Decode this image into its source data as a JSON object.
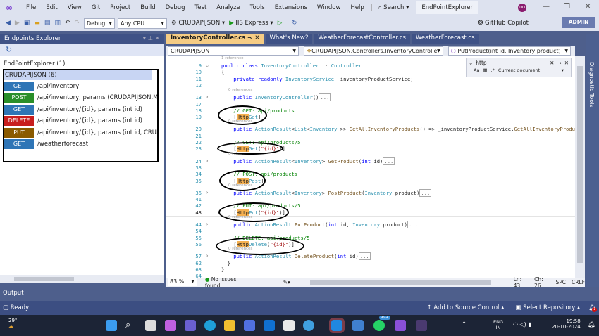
{
  "menu": [
    "File",
    "Edit",
    "View",
    "Git",
    "Project",
    "Build",
    "Debug",
    "Test",
    "Analyze",
    "Tools",
    "Extensions",
    "Window",
    "Help"
  ],
  "search_label": "Search",
  "solution_title": "EndPointExplorer",
  "avatar_initials": "DO",
  "toolbar": {
    "config": "Debug",
    "platform": "Any CPU",
    "startup": "CRUDAPIJSON",
    "run": "IIS Express",
    "copilot": "GitHub Copilot",
    "admin": "ADMIN"
  },
  "left_panel": {
    "title": "Endpoints Explorer",
    "root": "EndPointExplorer (1)",
    "group": "CRUDAPIJSON (6)",
    "endpoints": [
      {
        "verb": "GET",
        "path": "/api/inventory",
        "color": "#2e75b6"
      },
      {
        "verb": "POST",
        "path": "/api/inventory, params (CRUDAPIJSON.Model.Inventory",
        "color": "#2a8f2a"
      },
      {
        "verb": "GET",
        "path": "/api/inventory/{id}, params (int id)",
        "color": "#2e75b6"
      },
      {
        "verb": "DELETE",
        "path": "/api/inventory/{id}, params (int id)",
        "color": "#c81e1e"
      },
      {
        "verb": "PUT",
        "path": "/api/inventory/{id}, params (int id, CRUDAPIJSON.Mo",
        "color": "#8a5a00"
      },
      {
        "verb": "GET",
        "path": "/weatherforecast",
        "color": "#2e75b6"
      }
    ]
  },
  "tabs": [
    "InventoryController.cs",
    "What's New?",
    "WeatherForecastController.cs",
    "WeatherForecast.cs"
  ],
  "nav": {
    "project": "CRUDAPIJSON",
    "class": "CRUDAPIJSON.Controllers.InventoryController",
    "member": "PutProduct(int id, Inventory product)"
  },
  "find": {
    "value": "http",
    "scope": "Current document"
  },
  "code": [
    {
      "ref": "1 reference"
    },
    {
      "n": "9",
      "f": "v",
      "s": [
        [
          "kw",
          "public class "
        ],
        [
          "ty",
          "InventoryController"
        ],
        [
          "",
          "  : "
        ],
        [
          "ty",
          "Controller"
        ]
      ]
    },
    {
      "n": "10",
      "s": [
        [
          "",
          "{"
        ]
      ]
    },
    {
      "n": "11",
      "s": [
        [
          "kw",
          "    private readonly "
        ],
        [
          "ty",
          "InventoryService"
        ],
        [
          "",
          " _inventoryProductService;"
        ]
      ]
    },
    {
      "n": "12",
      "s": []
    },
    {
      "ref": "0 references"
    },
    {
      "n": "13",
      "f": ">",
      "s": [
        [
          "kw",
          "    public "
        ],
        [
          "ty",
          "InventoryController"
        ],
        [
          "",
          "()"
        ],
        [
          "col",
          "..."
        ]
      ]
    },
    {
      "n": "17",
      "s": []
    },
    {
      "n": "18",
      "s": [
        [
          "cm",
          "    // GET: api/products"
        ]
      ]
    },
    {
      "n": "19",
      "s": [
        [
          "",
          "    ["
        ],
        [
          "hl",
          "Http"
        ],
        [
          "ty",
          "Get"
        ],
        [
          "",
          "]"
        ]
      ]
    },
    {
      "ref": "0 references"
    },
    {
      "n": "20",
      "s": [
        [
          "kw",
          "    public "
        ],
        [
          "ty",
          "ActionResult"
        ],
        [
          "",
          "<"
        ],
        [
          "ty",
          "List"
        ],
        [
          "",
          "<"
        ],
        [
          "ty",
          "Inventory"
        ],
        [
          "",
          " >> "
        ],
        [
          "mt",
          "GetAllInventoryProducts"
        ],
        [
          "",
          "() => _inventoryProductService."
        ],
        [
          "mt",
          "GetAllInventoryProducts"
        ],
        [
          "",
          "("
        ]
      ]
    },
    {
      "n": "21",
      "s": []
    },
    {
      "n": "22",
      "s": [
        [
          "cm",
          "    // GET: api/products/5"
        ]
      ]
    },
    {
      "n": "23",
      "s": [
        [
          "",
          "    ["
        ],
        [
          "hl",
          "Http"
        ],
        [
          "ty",
          "Get"
        ],
        [
          "",
          "("
        ],
        [
          "st",
          "\"{id}\""
        ],
        [
          "",
          ")]"
        ]
      ]
    },
    {
      "ref": "0 references"
    },
    {
      "n": "24",
      "f": ">",
      "s": [
        [
          "kw",
          "    public "
        ],
        [
          "ty",
          "ActionResult"
        ],
        [
          "",
          "<"
        ],
        [
          "ty",
          "Inventory"
        ],
        [
          "",
          "> "
        ],
        [
          "mt",
          "GetProduct"
        ],
        [
          "",
          "("
        ],
        [
          "kw",
          "int"
        ],
        [
          "",
          " id)"
        ],
        [
          "col",
          "..."
        ]
      ]
    },
    {
      "n": "33",
      "s": []
    },
    {
      "n": "34",
      "s": [
        [
          "cm",
          "    // POST: api/products"
        ]
      ]
    },
    {
      "n": "35",
      "s": [
        [
          "",
          "    ["
        ],
        [
          "hl",
          "Http"
        ],
        [
          "ty",
          "Post"
        ],
        [
          "",
          "]"
        ]
      ]
    },
    {
      "ref": "0 references"
    },
    {
      "n": "36",
      "f": ">",
      "s": [
        [
          "kw",
          "    public "
        ],
        [
          "ty",
          "ActionResult"
        ],
        [
          "",
          "<"
        ],
        [
          "ty",
          "Inventory"
        ],
        [
          "",
          "> "
        ],
        [
          "mt",
          "PostProduct"
        ],
        [
          "",
          "("
        ],
        [
          "ty",
          "Inventory"
        ],
        [
          "",
          " product)"
        ],
        [
          "col",
          "..."
        ]
      ]
    },
    {
      "n": "41",
      "s": []
    },
    {
      "n": "42",
      "s": [
        [
          "cm",
          "    // PUT: api/products/5"
        ]
      ]
    },
    {
      "n": "43",
      "s": [
        [
          "",
          "    ["
        ],
        [
          "hl",
          "Http"
        ],
        [
          "ty",
          "Put"
        ],
        [
          "",
          "("
        ],
        [
          "st",
          "\"{id}\""
        ],
        [
          "",
          ")]"
        ]
      ]
    },
    {
      "ref": "0 references"
    },
    {
      "n": "44",
      "f": ">",
      "s": [
        [
          "kw",
          "    public "
        ],
        [
          "ty",
          "ActionResult"
        ],
        [
          "",
          " "
        ],
        [
          "mt",
          "PutProduct"
        ],
        [
          "",
          "("
        ],
        [
          "kw",
          "int"
        ],
        [
          "",
          " id, "
        ],
        [
          "ty",
          "Inventory"
        ],
        [
          "",
          " product)"
        ],
        [
          "col",
          "..."
        ]
      ]
    },
    {
      "n": "54",
      "s": []
    },
    {
      "n": "55",
      "s": [
        [
          "cm",
          "    // DELETE: api/products/5"
        ]
      ]
    },
    {
      "n": "56",
      "s": [
        [
          "",
          "    ["
        ],
        [
          "hl",
          "Http"
        ],
        [
          "ty",
          "Delete"
        ],
        [
          "",
          "("
        ],
        [
          "st",
          "\"{id}\""
        ],
        [
          "",
          ")]"
        ]
      ]
    },
    {
      "ref": "0 references"
    },
    {
      "n": "57",
      "f": ">",
      "s": [
        [
          "kw",
          "    public "
        ],
        [
          "ty",
          "ActionResult"
        ],
        [
          "",
          " "
        ],
        [
          "mt",
          "DeleteProduct"
        ],
        [
          "",
          "("
        ],
        [
          "kw",
          "int"
        ],
        [
          "",
          " id)"
        ],
        [
          "col",
          "..."
        ]
      ]
    },
    {
      "n": "62",
      "s": [
        [
          "",
          "  }"
        ]
      ]
    },
    {
      "n": "63",
      "s": [
        [
          "",
          "}"
        ]
      ]
    },
    {
      "n": "64",
      "s": []
    }
  ],
  "editor_status": {
    "zoom": "83 %",
    "issues": "No issues found",
    "ln": "Ln: 43",
    "ch": "Ch: 26",
    "spc": "SPC",
    "crlf": "CRLF"
  },
  "diagnostic_tools": "Diagnostic Tools",
  "output_label": "Output",
  "status": {
    "ready": "Ready",
    "source_control": "Add to Source Control",
    "repo": "Select Repository",
    "notifications": "1"
  },
  "taskbar": {
    "weather": "29°",
    "lang": "ENG",
    "region": "IN",
    "time": "19:58",
    "date": "20-10-2024",
    "whatsapp_badge": "99+"
  }
}
